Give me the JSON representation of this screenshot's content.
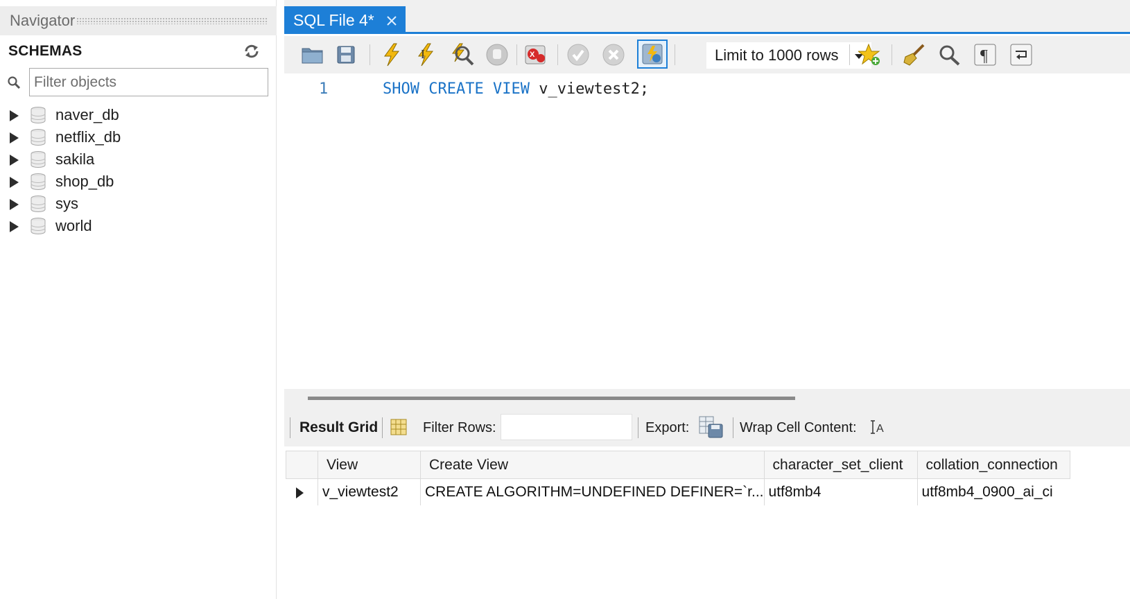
{
  "navigator": {
    "title": "Navigator",
    "schemas_label": "SCHEMAS",
    "filter_placeholder": "Filter objects",
    "schemas": [
      {
        "name": "naver_db"
      },
      {
        "name": "netflix_db"
      },
      {
        "name": "sakila"
      },
      {
        "name": "shop_db"
      },
      {
        "name": "sys"
      },
      {
        "name": "world"
      }
    ]
  },
  "editor_tab": {
    "title": "SQL File 4*"
  },
  "toolbar": {
    "limit_select": "Limit to 1000 rows"
  },
  "editor": {
    "line_number": "1",
    "code": {
      "kw1": "SHOW",
      "kw2": "CREATE",
      "kw3": "VIEW",
      "rest": "v_viewtest2;"
    }
  },
  "result_toolbar": {
    "result_grid": "Result Grid",
    "filter_rows": "Filter Rows:",
    "filter_rows_value": "",
    "export": "Export:",
    "wrap_cell": "Wrap Cell Content:"
  },
  "result_grid": {
    "columns": [
      "View",
      "Create View",
      "character_set_client",
      "collation_connection"
    ],
    "rows": [
      {
        "view": "v_viewtest2",
        "create_view": "CREATE ALGORITHM=UNDEFINED DEFINER=`r...",
        "character_set_client": "utf8mb4",
        "collation_connection": "utf8mb4_0900_ai_ci"
      }
    ]
  },
  "colors": {
    "accent": "#1d7fd7",
    "keyword": "#1b73c7",
    "toolbar_bg": "#f0f0f0"
  }
}
